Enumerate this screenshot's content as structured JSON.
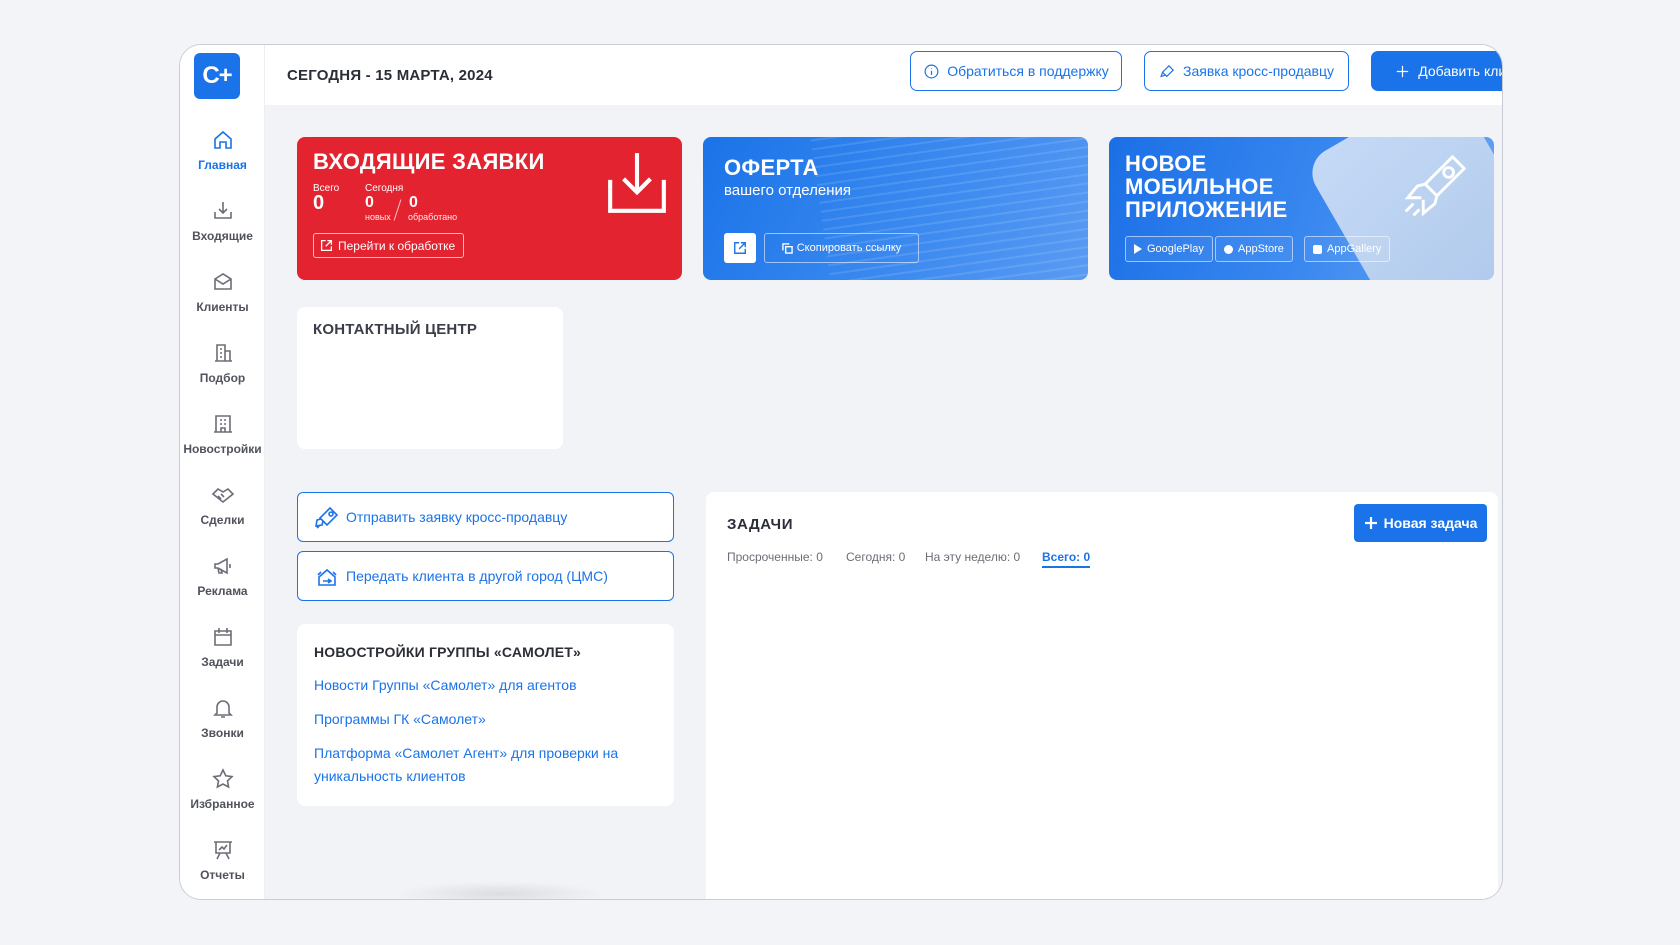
{
  "app": {
    "logo_text": "C+"
  },
  "header": {
    "date": "СЕГОДНЯ - 15 МАРТА, 2024",
    "support_label": "Обратиться в поддержку",
    "cross_sale_label": "Заявка кросс-продавцу",
    "add_client_label": "Добавить клиента"
  },
  "sidebar": {
    "items": [
      {
        "label": "Главная",
        "icon": "home-icon"
      },
      {
        "label": "Входящие",
        "icon": "inbox-icon"
      },
      {
        "label": "Клиенты",
        "icon": "clients-icon"
      },
      {
        "label": "Подбор",
        "icon": "building-icon"
      },
      {
        "label": "Новостройки",
        "icon": "newbuilding-icon"
      },
      {
        "label": "Сделки",
        "icon": "handshake-icon"
      },
      {
        "label": "Реклама",
        "icon": "megaphone-icon"
      },
      {
        "label": "Задачи",
        "icon": "calendar-icon"
      },
      {
        "label": "Звонки",
        "icon": "bell-icon"
      },
      {
        "label": "Избранное",
        "icon": "star-icon"
      },
      {
        "label": "Отчеты",
        "icon": "report-icon"
      }
    ]
  },
  "incoming": {
    "title": "ВХОДЯЩИЕ ЗАЯВКИ",
    "total_label": "Всего",
    "total_value": "0",
    "today_label": "Сегодня",
    "new_value": "0",
    "new_label": "новых",
    "processed_value": "0",
    "processed_label": "обработано",
    "link_label": "Перейти к обработке"
  },
  "offer": {
    "title": "ОФЕРТА",
    "subtitle": "вашего отделения",
    "copy_label": "Скопировать ссылку"
  },
  "mobile_app": {
    "title_line1": "НОВОЕ",
    "title_line2": "МОБИЛЬНОЕ",
    "title_line3": "ПРИЛОЖЕНИЕ",
    "stores": [
      "GooglePlay",
      "AppStore",
      "AppGallery"
    ]
  },
  "contact_center": {
    "title": "КОНТАКТНЫЙ ЦЕНТР"
  },
  "actions": {
    "send_cross_sale": "Отправить заявку кросс-продавцу",
    "transfer_client": "Передать клиента в другой город (ЦМС)"
  },
  "news": {
    "title": "НОВОСТРОЙКИ ГРУППЫ «САМОЛЕТ»",
    "links": [
      "Новости Группы «Самолет» для агентов",
      "Программы ГК «Самолет»",
      "Платформа «Самолет Агент» для проверки на уникальность клиентов"
    ]
  },
  "tasks": {
    "title": "ЗАДАЧИ",
    "new_task_label": "Новая задача",
    "filters": [
      "Просроченные: 0",
      "Сегодня: 0",
      "На эту неделю: 0",
      "Всего: 0"
    ],
    "active_filter": "Всего: 0"
  },
  "colors": {
    "accent": "#1a73e8",
    "danger": "#e3232f",
    "background": "#f2f3f7"
  }
}
